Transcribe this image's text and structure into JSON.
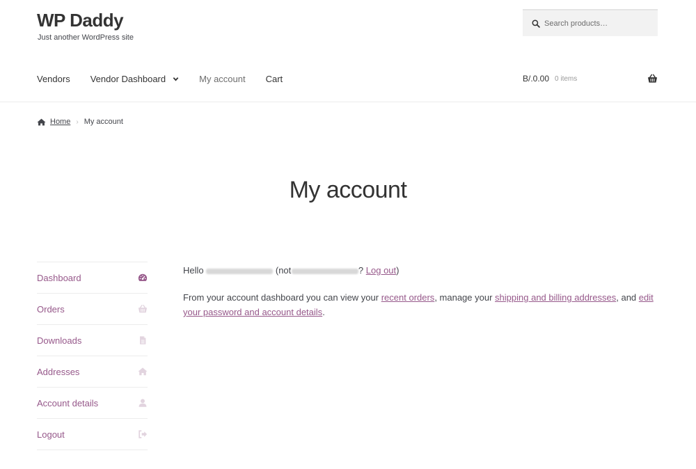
{
  "site": {
    "title": "WP Daddy",
    "description": "Just another WordPress site"
  },
  "search": {
    "placeholder": "Search products…",
    "icon": "search-icon"
  },
  "nav": {
    "items": [
      {
        "label": "Vendors"
      },
      {
        "label": "Vendor Dashboard",
        "has_dropdown": true
      },
      {
        "label": "My account",
        "current": true
      },
      {
        "label": "Cart"
      }
    ]
  },
  "cart": {
    "amount": "B/.0.00",
    "count": "0 items",
    "icon": "basket-icon"
  },
  "breadcrumb": {
    "home": "Home",
    "current": "My account"
  },
  "page": {
    "title": "My account"
  },
  "account_nav": {
    "items": [
      {
        "label": "Dashboard",
        "icon": "dashboard-icon",
        "active": true
      },
      {
        "label": "Orders",
        "icon": "basket-icon"
      },
      {
        "label": "Downloads",
        "icon": "file-icon"
      },
      {
        "label": "Addresses",
        "icon": "home-icon"
      },
      {
        "label": "Account details",
        "icon": "user-icon"
      },
      {
        "label": "Logout",
        "icon": "logout-icon"
      }
    ]
  },
  "content": {
    "hello": "Hello",
    "not_open": "(not",
    "question": "?",
    "logout": "Log out",
    "close_paren": ")",
    "intro": "From your account dashboard you can view your",
    "recent_orders": "recent orders",
    "manage": ", manage your",
    "addresses": "shipping and billing addresses",
    "and": ", and",
    "edit": "edit your password and account details",
    "period": "."
  },
  "colors": {
    "accent": "#96588a",
    "text": "#43454b",
    "heading": "#333333"
  }
}
